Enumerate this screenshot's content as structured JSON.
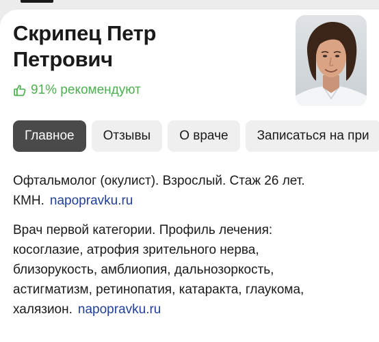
{
  "profile": {
    "name_line1": "Скрипец Петр",
    "name_line2": "Петрович",
    "recommend_text": "91% рекомендуют",
    "recommend_icon": "thumbs-up-icon",
    "recommend_color": "#4caf50"
  },
  "tabs": [
    {
      "label": "Главное",
      "active": true
    },
    {
      "label": "Отзывы",
      "active": false
    },
    {
      "label": "О враче",
      "active": false
    },
    {
      "label": "Записаться на при",
      "active": false
    }
  ],
  "description": {
    "line1": "Офтальмолог (окулист). Взрослый. Стаж 26 лет.",
    "line2": "КМН.",
    "link1": "napopravku.ru",
    "para2_line1": "Врач первой категории. Профиль лечения:",
    "para2_line2": "косоглазие, атрофия зрительного нерва,",
    "para2_line3": "близорукость, амблиопия, дальнозоркость,",
    "para2_line4": "астигматизм, ретинопатия, катаракта, глаукома,",
    "para2_line5": "халязион.",
    "link2": "napopravku.ru"
  },
  "colors": {
    "active_tab_bg": "#4a4a4a",
    "tab_bg": "#efefef",
    "link": "#1f3f9a"
  }
}
